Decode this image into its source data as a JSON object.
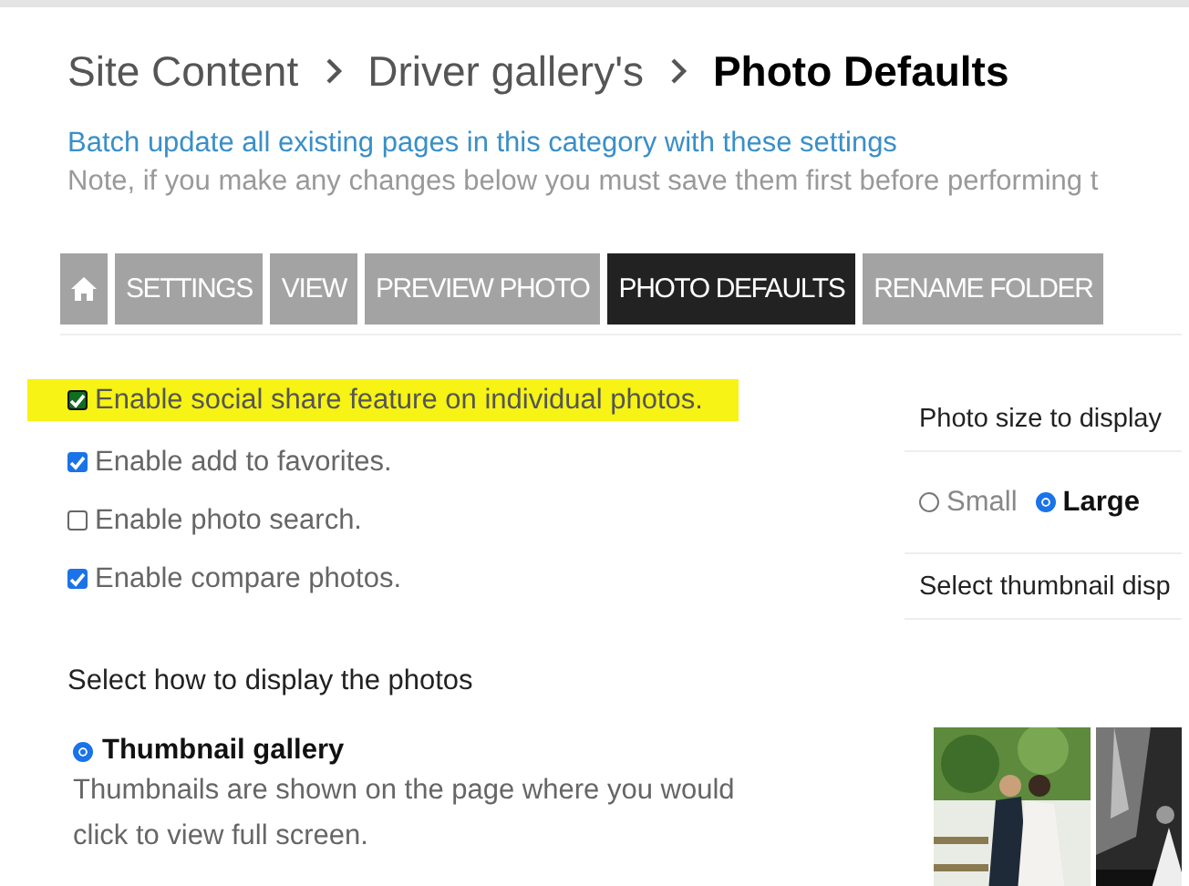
{
  "breadcrumb": [
    {
      "text": "Site Content",
      "current": false
    },
    {
      "text": "Driver gallery's",
      "current": false
    },
    {
      "text": "Photo Defaults",
      "current": true
    }
  ],
  "batch_link": "Batch update all existing pages in this category with these settings",
  "note": "Note, if you make any changes below you must save them first before performing t",
  "tabs": [
    {
      "kind": "home",
      "selected": false
    },
    {
      "kind": "text",
      "label": "SETTINGS",
      "selected": false
    },
    {
      "kind": "text",
      "label": "VIEW",
      "selected": false
    },
    {
      "kind": "text",
      "label": "PREVIEW PHOTO",
      "selected": false
    },
    {
      "kind": "text",
      "label": "PHOTO DEFAULTS",
      "selected": true
    },
    {
      "kind": "text",
      "label": "RENAME FOLDER",
      "selected": false
    }
  ],
  "features": [
    {
      "label": "Enable social share feature on individual photos.",
      "checked": true,
      "highlighted": true
    },
    {
      "label": "Enable add to favorites.",
      "checked": true,
      "highlighted": false
    },
    {
      "label": "Enable photo search.",
      "checked": false,
      "highlighted": false
    },
    {
      "label": "Enable compare photos.",
      "checked": true,
      "highlighted": false
    }
  ],
  "display": {
    "heading": "Select how to display the photos",
    "options": [
      {
        "label": "Thumbnail gallery",
        "description": "Thumbnails are shown on the page where you would click to view full screen.",
        "selected": true
      }
    ]
  },
  "photo_size": {
    "label": "Photo size to display",
    "options": [
      {
        "label": "Small",
        "selected": false
      },
      {
        "label": "Large",
        "selected": true
      }
    ]
  },
  "thumbnail_display": {
    "label": "Select thumbnail disp"
  }
}
